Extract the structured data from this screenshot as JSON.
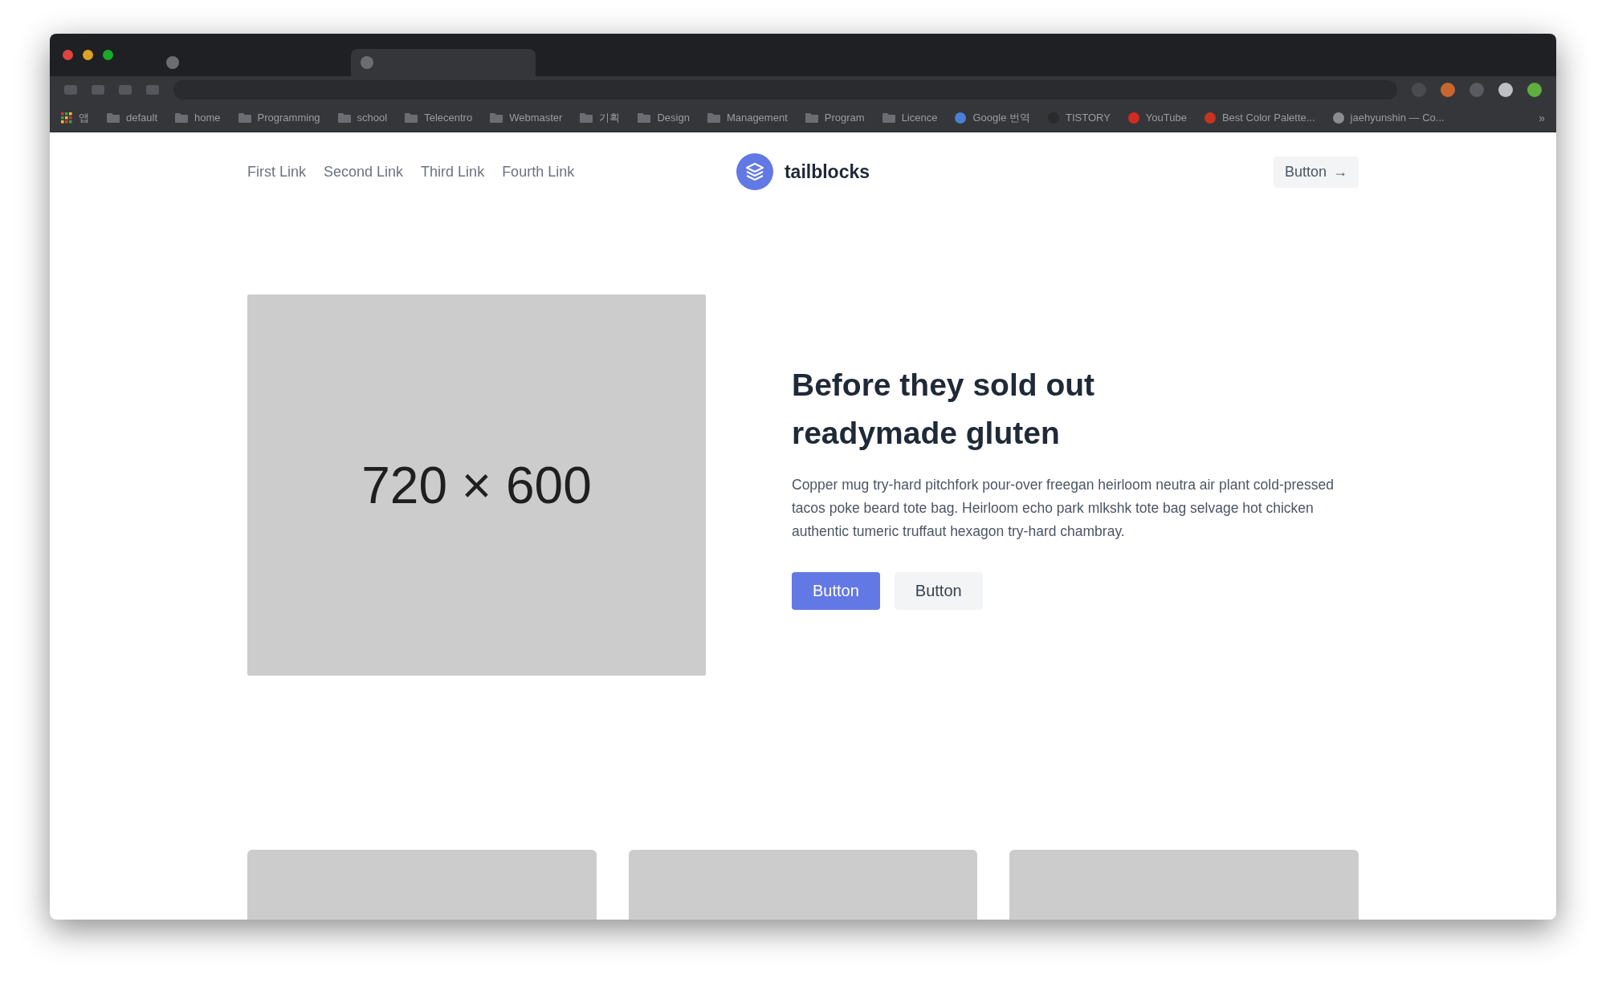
{
  "browser": {
    "bookmarks": [
      {
        "kind": "apps",
        "label": "앱"
      },
      {
        "kind": "folder",
        "label": "default"
      },
      {
        "kind": "folder",
        "label": "home"
      },
      {
        "kind": "folder",
        "label": "Programming"
      },
      {
        "kind": "folder",
        "label": "school"
      },
      {
        "kind": "folder",
        "label": "Telecentro"
      },
      {
        "kind": "folder",
        "label": "Webmaster"
      },
      {
        "kind": "folder",
        "label": "기획"
      },
      {
        "kind": "folder",
        "label": "Design"
      },
      {
        "kind": "folder",
        "label": "Management"
      },
      {
        "kind": "folder",
        "label": "Program"
      },
      {
        "kind": "folder",
        "label": "Licence"
      },
      {
        "kind": "site",
        "label": "Google 번역",
        "color": "#4a7fd6"
      },
      {
        "kind": "site",
        "label": "TISTORY",
        "color": "#2a2a2a"
      },
      {
        "kind": "site",
        "label": "YouTube",
        "color": "#d32a22"
      },
      {
        "kind": "site",
        "label": "Best Color Palette...",
        "color": "#c8341f"
      },
      {
        "kind": "site",
        "label": "jaehyunshin — Co...",
        "color": "#8a8c90"
      }
    ],
    "overflow": "»"
  },
  "nav": {
    "links": [
      "First Link",
      "Second Link",
      "Third Link",
      "Fourth Link"
    ],
    "brand": "tailblocks",
    "button": {
      "label": "Button",
      "arrow": "→"
    }
  },
  "hero": {
    "image_label": "720 × 600",
    "heading_lines": [
      "Before they sold out",
      "readymade gluten"
    ],
    "text": "Copper mug try-hard pitchfork pour-over freegan heirloom neutra air plant cold-pressed tacos poke beard tote bag. Heirloom echo park mlkshk tote bag selvage hot chicken authentic tumeric truffaut hexagon try-hard chambray.",
    "buttons": [
      {
        "label": "Button",
        "kind": "primary"
      },
      {
        "label": "Button",
        "kind": "secondary"
      }
    ]
  },
  "cards": [
    {
      "kind": "placeholder"
    },
    {
      "kind": "placeholder"
    },
    {
      "kind": "placeholder"
    }
  ]
}
